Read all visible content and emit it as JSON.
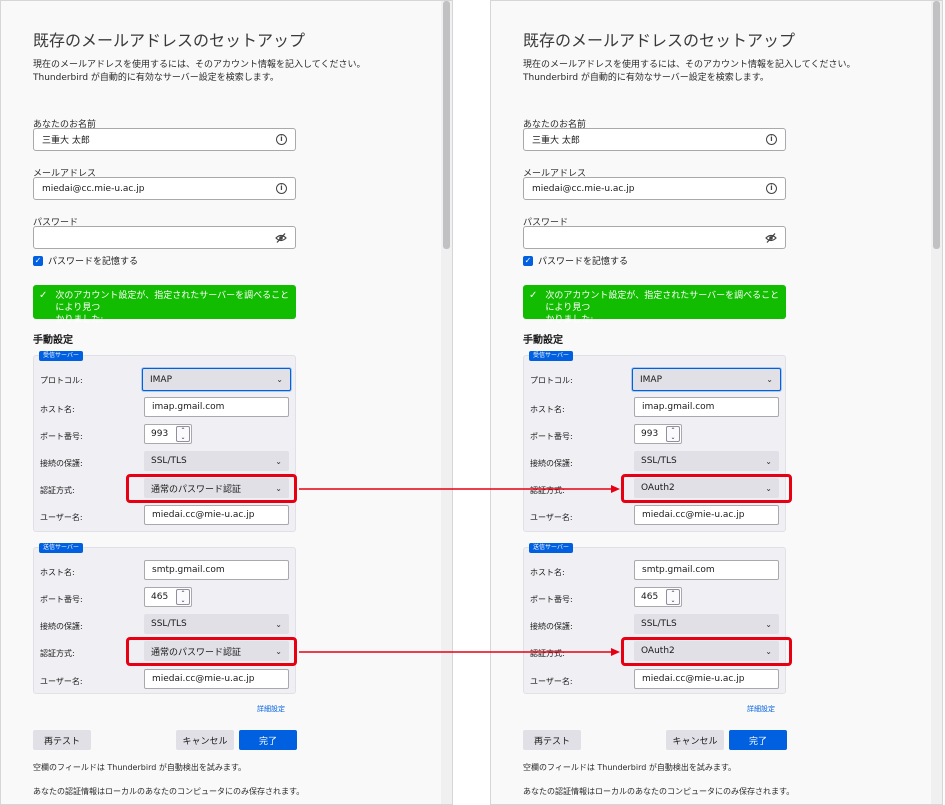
{
  "dialog": {
    "title": "既存のメールアドレスのセットアップ",
    "desc_line1": "現在のメールアドレスを使用するには、そのアカウント情報を記入してください。",
    "desc_line2": "Thunderbird が自動的に有効なサーバー設定を検索します。",
    "name_label": "あなたのお名前",
    "name_value": "三重大 太郎",
    "email_label": "メールアドレス",
    "email_value": "miedai@cc.mie-u.ac.jp",
    "password_label": "パスワード",
    "password_value": "",
    "remember_label": "パスワードを記憶する",
    "remember_checked": true,
    "notice_line1": "次のアカウント設定が、指定されたサーバーを調べることにより見つ",
    "notice_line2": "かりました:",
    "manual_heading": "手動設定",
    "incoming": {
      "badge": "受信サーバー",
      "protocol_label": "プロトコル:",
      "protocol_value": "IMAP",
      "host_label": "ホスト名:",
      "host_value": "imap.gmail.com",
      "port_label": "ポート番号:",
      "port_value": "993",
      "security_label": "接続の保護:",
      "security_value": "SSL/TLS",
      "auth_label": "認証方式:",
      "username_label": "ユーザー名:",
      "username_value": "miedai.cc@mie-u.ac.jp"
    },
    "outgoing": {
      "badge": "送信サーバー",
      "host_label": "ホスト名:",
      "host_value": "smtp.gmail.com",
      "port_label": "ポート番号:",
      "port_value": "465",
      "security_label": "接続の保護:",
      "security_value": "SSL/TLS",
      "auth_label": "認証方式:",
      "username_label": "ユーザー名:",
      "username_value": "miedai.cc@mie-u.ac.jp"
    },
    "advanced_link": "詳細設定",
    "retest_button": "再テスト",
    "cancel_button": "キャンセル",
    "done_button": "完了",
    "footer_line1": "空欄のフィールドは Thunderbird が自動検出を試みます。",
    "footer_line2": "あなたの認証情報はローカルのあなたのコンピュータにのみ保存されます。"
  },
  "before": {
    "incoming_auth_value": "通常のパスワード認証",
    "outgoing_auth_value": "通常のパスワード認証"
  },
  "after": {
    "incoming_auth_value": "OAuth2",
    "outgoing_auth_value": "OAuth2"
  },
  "icons": {
    "info": "info-icon",
    "eye": "eye-slash-icon",
    "check": "checkmark-icon",
    "chevron": "chevron-down-icon",
    "arrow": "arrow-right-icon"
  },
  "colors": {
    "highlight": "#e60012",
    "accent": "#0060df",
    "success": "#12bc00"
  }
}
